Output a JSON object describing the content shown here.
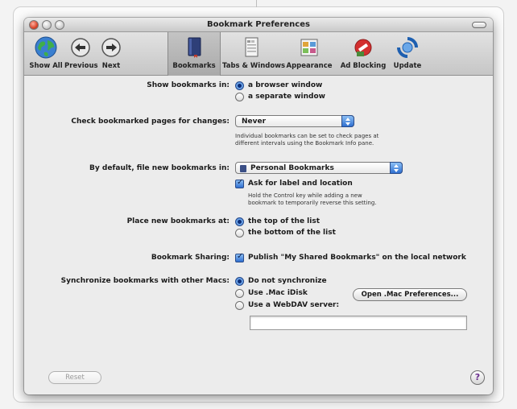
{
  "window": {
    "title": "Bookmark Preferences"
  },
  "toolbar": {
    "items": [
      {
        "label": "Show All",
        "icon": "globe-icon"
      },
      {
        "label": "Previous",
        "icon": "previous-arrow-icon"
      },
      {
        "label": "Next",
        "icon": "next-arrow-icon"
      },
      {
        "label": "Bookmarks",
        "icon": "bookmark-book-icon",
        "selected": true
      },
      {
        "label": "Tabs & Windows",
        "icon": "tabs-windows-icon"
      },
      {
        "label": "Appearance",
        "icon": "appearance-icon"
      },
      {
        "label": "Ad Blocking",
        "icon": "ad-blocking-icon"
      },
      {
        "label": "Update",
        "icon": "update-icon"
      }
    ]
  },
  "show_bookmarks": {
    "label": "Show bookmarks in:",
    "options": [
      "a browser window",
      "a separate window"
    ],
    "selected": 0
  },
  "check_changes": {
    "label": "Check bookmarked pages for changes:",
    "value": "Never",
    "note_line1": "Individual bookmarks can be set to check pages at",
    "note_line2": "different intervals using the Bookmark Info pane."
  },
  "file_new": {
    "label": "By default, file new bookmarks in:",
    "value": "Personal Bookmarks",
    "ask_label": "Ask for label and location",
    "ask_checked": true,
    "note_line1": "Hold the Control key while adding a new",
    "note_line2": "bookmark to temporarily reverse this setting."
  },
  "place_new": {
    "label": "Place new bookmarks at:",
    "options": [
      "the top of the list",
      "the bottom of the list"
    ],
    "selected": 0
  },
  "sharing": {
    "label": "Bookmark Sharing:",
    "checkbox_label": "Publish \"My Shared Bookmarks\" on the local network",
    "checked": true
  },
  "sync": {
    "label": "Synchronize bookmarks with other Macs:",
    "options": [
      "Do not synchronize",
      "Use .Mac iDisk",
      "Use a WebDAV server:"
    ],
    "selected": 0,
    "open_mac_button": "Open .Mac Preferences...",
    "webdav_value": ""
  },
  "footer": {
    "reset_button": "Reset",
    "help_label": "?"
  },
  "colors": {
    "selection_blue": "#2f6fd0",
    "window_bg": "#ececec"
  }
}
